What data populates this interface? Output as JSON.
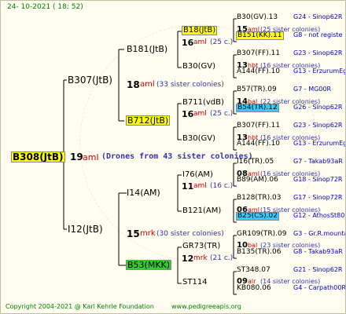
{
  "date": "24- 10-2021 ( 18: 52)",
  "root": {
    "name": "B308(JtB)",
    "num": "19",
    "aml": "aml",
    "note": "(Drones from 43 sister colonies)"
  },
  "gen1": [
    {
      "name": "B307(JtB)",
      "num": "18",
      "aml": "aml",
      "note": "(33 sister colonies)"
    },
    {
      "name": "I12(JtB)",
      "num": "15",
      "aml": "mrk",
      "note": "(30 sister colonies)"
    }
  ],
  "gen2": [
    {
      "name": "B181(JtB)",
      "num": "16",
      "aml": "aml",
      "note": "(25 c.)"
    },
    {
      "name": "B712(JtB)",
      "num": "16",
      "aml": "aml",
      "note": "(25 c.)"
    },
    {
      "name": "I14(AM)",
      "num": "11",
      "aml": "aml",
      "note": "(16 c.)"
    },
    {
      "name": "B53(MKK)",
      "num": "12",
      "aml": "mrk",
      "note": "(21 c.)"
    }
  ],
  "gen3": [
    {
      "name": "B18(JtB)",
      "num": "15",
      "aml": "aml",
      "note": "(25 sister colonies)"
    },
    {
      "name": "B30(GV)",
      "num": "13",
      "aml": "hbt",
      "note": "(16 sister colonies)"
    },
    {
      "name": "B711(vdB)",
      "num": "14",
      "aml": "bal",
      "note": "(22 sister colonies)"
    },
    {
      "name": "B30(GV)",
      "num": "13",
      "aml": "hbt",
      "note": "(16 sister colonies)"
    },
    {
      "name": "I76(AM)",
      "num": "08",
      "aml": "aml",
      "note": "(16 sister colonies)"
    },
    {
      "name": "B121(AM)",
      "num": "06",
      "aml": "aml",
      "note": "(15 sister colonies)"
    },
    {
      "name": "GR73(TR)",
      "num": "10",
      "aml": "bal",
      "note": "(23 sister colonies)"
    },
    {
      "name": "ST114",
      "num": "09",
      "aml": "alr",
      "note": "(14 sister colonies)"
    }
  ],
  "gen4": [
    {
      "name": "B30(GV).13",
      "code": "G24 - Sinop62R"
    },
    {
      "name": "B151(KK).11",
      "code": "G8 - not registe"
    },
    {
      "name": "B307(FF).11",
      "code": "G23 - Sinop62R"
    },
    {
      "name": "A144(FF).10",
      "code": "G13 - ErzurumEgg8"
    },
    {
      "name": "B57(TR).09",
      "code": "G7 - MG00R"
    },
    {
      "name": "B54(TR).12",
      "code": "G26 - Sinop62R"
    },
    {
      "name": "B307(FF).11",
      "code": "G23 - Sinop62R"
    },
    {
      "name": "A144(FF).10",
      "code": "G13 - ErzurumEgg8"
    },
    {
      "name": "I16(TR).05",
      "code": "G7 - Takab93aR"
    },
    {
      "name": "B89(AM).06",
      "code": "G18 - Sinop72R"
    },
    {
      "name": "B128(TR).03",
      "code": "G17 - Sinop72R"
    },
    {
      "name": "B25(CS).02",
      "code": "G12 - AthosSt80R"
    },
    {
      "name": "GR109(TR).09",
      "code": "G3 - Gr.R.mounta"
    },
    {
      "name": "B135(TR).06",
      "code": "G8 - Takab93aR"
    },
    {
      "name": "ST348.07",
      "code": "G21 - Sinop62R"
    },
    {
      "name": "KB080.06",
      "code": "G4 - Carpath00R"
    }
  ],
  "footer": {
    "copyright": "Copyright 2004-2021 @ Karl Kehrle Foundation",
    "url": "www.pedigreeapis.org"
  },
  "colors": {
    "name": "#000000",
    "num": "#000000",
    "aml": "#cc0000",
    "note": "#3333aa",
    "code": "#0000cc",
    "footer": "#008000",
    "date": "#008000",
    "line": "#000000",
    "highlight_yellow": "#ffff00",
    "highlight_green": "#33cc33",
    "highlight_cyan": "#33ccff"
  }
}
